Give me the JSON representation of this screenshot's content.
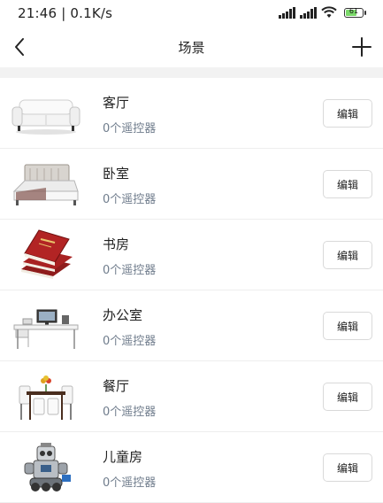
{
  "status_bar": {
    "time": "21:46 | 0.1K/s",
    "battery": "61"
  },
  "nav": {
    "title": "场景"
  },
  "scenes": [
    {
      "name": "客厅",
      "count": "0个遥控器",
      "edit_label": "编辑",
      "icon": "sofa-icon"
    },
    {
      "name": "卧室",
      "count": "0个遥控器",
      "edit_label": "编辑",
      "icon": "bed-icon"
    },
    {
      "name": "书房",
      "count": "0个遥控器",
      "edit_label": "编辑",
      "icon": "books-icon"
    },
    {
      "name": "办公室",
      "count": "0个遥控器",
      "edit_label": "编辑",
      "icon": "desk-icon"
    },
    {
      "name": "餐厅",
      "count": "0个遥控器",
      "edit_label": "编辑",
      "icon": "dining-table-icon"
    },
    {
      "name": "儿童房",
      "count": "0个遥控器",
      "edit_label": "编辑",
      "icon": "robot-toy-icon"
    }
  ],
  "colors": {
    "subtext": "#6f7c8c",
    "divider": "#f2f2f2",
    "battery_fill": "#7bd96a"
  }
}
